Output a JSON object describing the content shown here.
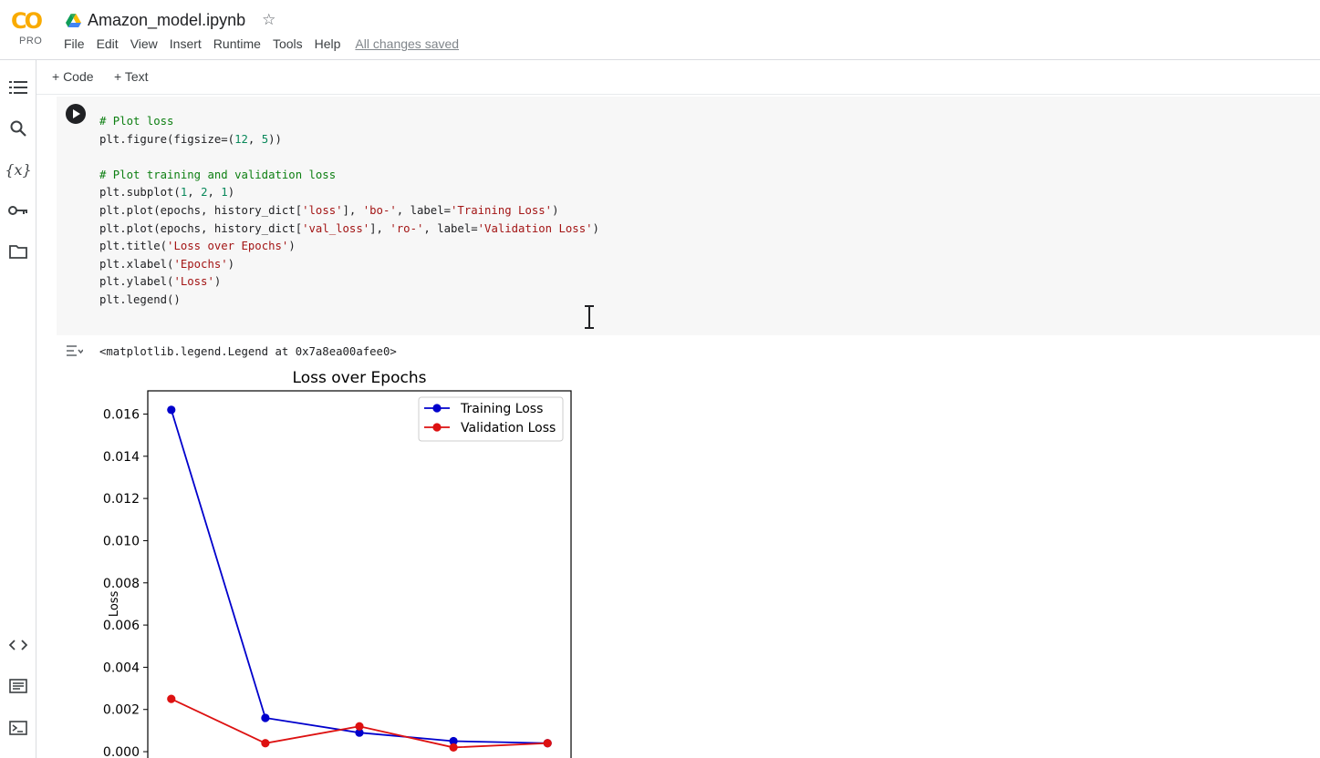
{
  "app": {
    "logo_text": "CO",
    "plan": "PRO",
    "notebook_title": "Amazon_model.ipynb",
    "save_status": "All changes saved",
    "menu": [
      "File",
      "Edit",
      "View",
      "Insert",
      "Runtime",
      "Tools",
      "Help"
    ]
  },
  "sidebar": {
    "icons": [
      "table-of-contents-icon",
      "search-icon",
      "variables-icon",
      "secrets-key-icon",
      "files-folder-icon",
      "code-snippets-icon",
      "command-palette-icon",
      "terminal-icon"
    ]
  },
  "toolbar": {
    "add_code": "+ Code",
    "add_text": "+ Text"
  },
  "cell": {
    "code_lines": [
      {
        "kind": "comment",
        "text": "# Plot loss"
      },
      {
        "kind": "code",
        "text": "plt.figure(figsize=(12, 5))"
      },
      {
        "kind": "blank",
        "text": ""
      },
      {
        "kind": "comment",
        "text": "# Plot training and validation loss"
      },
      {
        "kind": "code",
        "text": "plt.subplot(1, 2, 1)"
      },
      {
        "kind": "code",
        "text": "plt.plot(epochs, history_dict['loss'], 'bo-', label='Training Loss')"
      },
      {
        "kind": "code",
        "text": "plt.plot(epochs, history_dict['val_loss'], 'ro-', label='Validation Loss')"
      },
      {
        "kind": "code",
        "text": "plt.title('Loss over Epochs')"
      },
      {
        "kind": "code",
        "text": "plt.xlabel('Epochs')"
      },
      {
        "kind": "code",
        "text": "plt.ylabel('Loss')"
      },
      {
        "kind": "code",
        "text": "plt.legend()"
      }
    ],
    "output_text": "<matplotlib.legend.Legend at 0x7a8ea00afee0>"
  },
  "chart_data": {
    "type": "line",
    "title": "Loss over Epochs",
    "xlabel": "",
    "ylabel": "Loss",
    "x": [
      1,
      2,
      3,
      4,
      5
    ],
    "xlim": [
      0.75,
      5.25
    ],
    "ylim": [
      -0.0003,
      0.0171
    ],
    "yticks": [
      0.0,
      0.002,
      0.004,
      0.006,
      0.008,
      0.01,
      0.012,
      0.014,
      0.016
    ],
    "ytick_labels": [
      "0.000",
      "0.002",
      "0.004",
      "0.006",
      "0.008",
      "0.010",
      "0.012",
      "0.014",
      "0.016"
    ],
    "grid": false,
    "legend_position": "top-right",
    "series": [
      {
        "name": "Training Loss",
        "color": "#0000cc",
        "values": [
          0.0162,
          0.0016,
          0.0009,
          0.0005,
          0.0004
        ]
      },
      {
        "name": "Validation Loss",
        "color": "#dd1111",
        "values": [
          0.0025,
          0.0004,
          0.0012,
          0.0002,
          0.0004
        ]
      }
    ]
  }
}
